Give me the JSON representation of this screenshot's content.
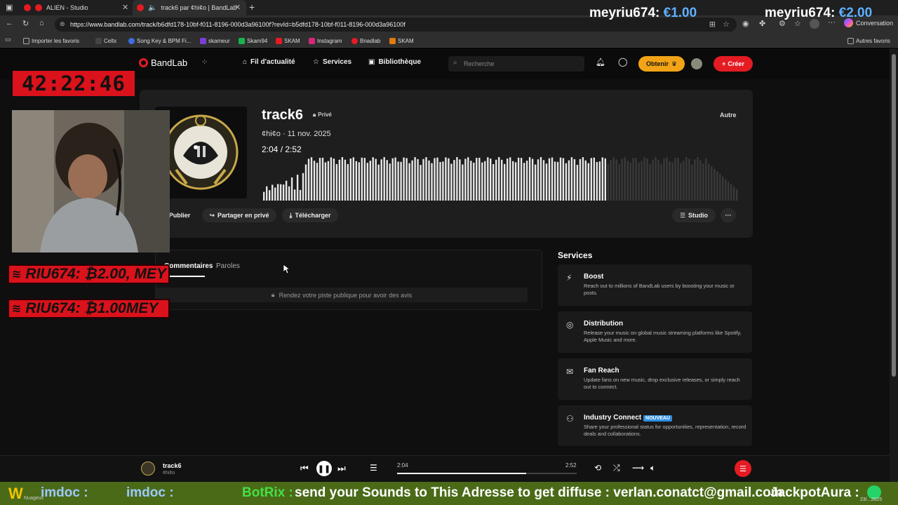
{
  "browser": {
    "tabs": [
      {
        "title": "ALIEN - Studio"
      },
      {
        "title": "track6 par ¢hi¢o | BandLab"
      }
    ],
    "url": "https://www.bandlab.com/track/b6dfd178-10bf-f011-8196-000d3a96100f?revId=b5dfd178-10bf-f011-8196-000d3a96100f",
    "conversation_label": "Conversation",
    "bookmarks": [
      "Importer les favoris",
      "Celtx",
      "Song Key & BPM Fi...",
      "skameur",
      "Skam94",
      "SKAM",
      "Instagram",
      "Bnadlab",
      "SKAM"
    ],
    "other_favorites": "Autres favoris",
    "colors": {
      "bar": "#1f1f1f",
      "accent": "#e51b23"
    }
  },
  "nav": {
    "logo": "BandLab",
    "links": [
      "Fil d'actualité",
      "Services",
      "Bibliothèque"
    ],
    "search_placeholder": "Recherche",
    "obtenir": "Obtenir",
    "creer": "Créer"
  },
  "track": {
    "title": "track6",
    "privacy": "Privé",
    "artist_date": "¢hi¢o · 11 nov. 2025",
    "elapsed": "2:04",
    "duration": "2:52",
    "genre": "Autre",
    "played_fraction": 0.72,
    "actions": {
      "publish": "Publier",
      "share": "Partager en privé",
      "download": "Télécharger",
      "studio": "Studio"
    }
  },
  "comments": {
    "tabs": [
      "Commentaires",
      "Paroles"
    ],
    "notice": "Rendez votre piste publique pour avoir des avis"
  },
  "services": {
    "heading": "Services",
    "items": [
      {
        "title": "Boost",
        "desc": "Reach out to millions of BandLab users by boosting your music or posts.",
        "icon": "lightning-icon"
      },
      {
        "title": "Distribution",
        "desc": "Release your music on global music streaming platforms like Spotify, Apple Music and more.",
        "icon": "distribution-icon"
      },
      {
        "title": "Fan Reach",
        "desc": "Update fans on new music, drop exclusive releases, or simply reach out to connect.",
        "icon": "mail-icon"
      },
      {
        "title": "Industry Connect",
        "badge": "NOUVEAU",
        "desc": "Share your professional status for opportunities, representation, record deals and collaborations.",
        "icon": "people-icon"
      }
    ]
  },
  "player": {
    "title": "track6",
    "artist": "¢hi¢o",
    "elapsed": "2:04",
    "duration": "2:52",
    "progress_fraction": 0.72
  },
  "overlay": {
    "timer": "42:22:46",
    "donations": [
      "RIU674: ₿2.00, MEY",
      "RIU674: ₿1.00MEY"
    ],
    "top_donations": [
      {
        "name": "meyriu674:",
        "amount": "€1.00"
      },
      {
        "name": "meyriu674:",
        "amount": "€2.00"
      }
    ],
    "ticker": [
      "imdoc :",
      "imdoc :",
      "BotRix :",
      "send your Sounds to This Adresse to get diffuse : verlan.conatct@gmail.com",
      "JackpotAura :"
    ],
    "ticker_weather": "Nuageux",
    "ticker_date": "23/...2025"
  }
}
